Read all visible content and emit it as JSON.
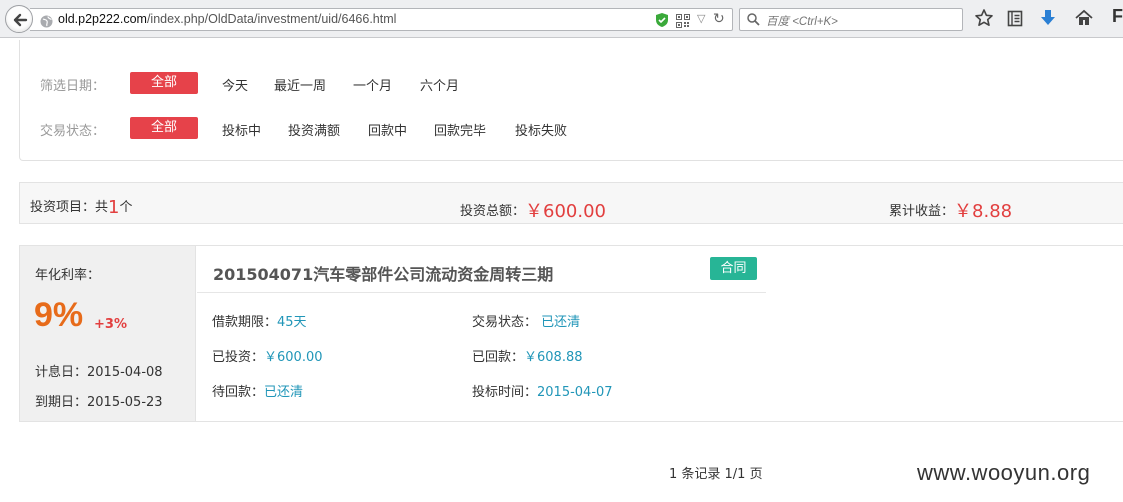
{
  "browser": {
    "url_host": "old.p2p222.com",
    "url_path": "/index.php/OldData/investment/uid/6466.html",
    "search_placeholder": "百度 <Ctrl+K>",
    "menu_glyph": "F"
  },
  "filter": {
    "date": {
      "label": "筛选日期：",
      "options": [
        "全部",
        "今天",
        "最近一周",
        "一个月",
        "六个月"
      ],
      "selected": "全部"
    },
    "status": {
      "label": "交易状态：",
      "options": [
        "全部",
        "投标中",
        "投资满额",
        "回款中",
        "回款完毕",
        "投标失败"
      ],
      "selected": "全部"
    }
  },
  "summary": {
    "projects_prefix": "投资项目：共",
    "projects_count": "1",
    "projects_suffix": "个",
    "total_label": "投资总额：",
    "total_value": "￥600.00",
    "earnings_label": "累计收益：",
    "earnings_value": "￥8.88"
  },
  "investment": {
    "rate_label": "年化利率：",
    "rate": "9%",
    "bonus_rate": "+3%",
    "interest_start": "计息日：2015-04-08",
    "maturity": "到期日：2015-05-23",
    "title": "201504071汽车零部件公司流动资金周转三期",
    "contract_label": "合同",
    "term_label": "借款期限：",
    "term_value": "45天",
    "status_label": "交易状态：",
    "status_value": "已还清",
    "invested_label": "已投资：",
    "invested_value": "￥600.00",
    "returned_label": "已回款：",
    "returned_value": "￥608.88",
    "pending_label": "待回款：",
    "pending_value": "已还清",
    "bid_time_label": "投标时间：",
    "bid_time_value": "2015-04-07"
  },
  "pagination": {
    "text": "1 条记录 1/1 页"
  },
  "watermark": "www.wooyun.org",
  "colors": {
    "accent_red": "#e6424a",
    "rate_orange": "#e76b1a",
    "link_blue": "#2196b8",
    "contract_green": "#27b596"
  },
  "icons": [
    "back-arrow-icon",
    "globe-icon",
    "shield-icon",
    "qr-code-icon",
    "dropdown-icon",
    "reload-icon",
    "search-icon",
    "star-icon",
    "reading-list-icon",
    "download-icon",
    "home-icon"
  ]
}
